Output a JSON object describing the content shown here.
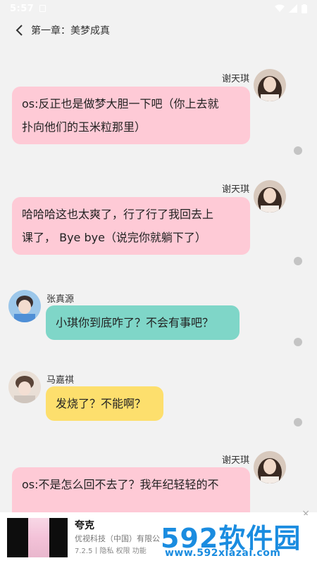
{
  "status_bar": {
    "time": "5:57"
  },
  "header": {
    "title": "第一章：美梦成真"
  },
  "messages": [
    {
      "speaker": "谢天琪",
      "side": "right",
      "color": "pink",
      "text_lines": [
        "os:反正也是做梦大胆一下吧（你上去就",
        "扑向他们的玉米粒那里）"
      ]
    },
    {
      "speaker": "谢天琪",
      "side": "right",
      "color": "pink",
      "text_lines": [
        "哈哈哈这也太爽了，行了行了我回去上",
        "课了， Bye bye（说完你就躺下了）"
      ]
    },
    {
      "speaker": "张真源",
      "side": "left",
      "color": "teal",
      "text_lines": [
        "小琪你到底咋了？不会有事吧？"
      ]
    },
    {
      "speaker": "马嘉祺",
      "side": "left",
      "color": "yellow",
      "text_lines": [
        "发烧了？不能啊？"
      ]
    },
    {
      "speaker": "谢天琪",
      "side": "right",
      "color": "pink",
      "text_lines": [
        "os:不是怎么回不去了？我年纪轻轻的不"
      ]
    }
  ],
  "ad": {
    "app_name": "夸克",
    "company": "优视科技（中国）有限公司",
    "meta": "7.2.5丨隐私 权限 功能",
    "close": "×"
  },
  "watermark": {
    "logo_num": "592",
    "logo_cn": "软件园",
    "url": "www.592xiazai.com"
  },
  "colors": {
    "pink": "#fecad6",
    "teal": "#7fd6c8",
    "yellow": "#fddf6d",
    "background": "#f2f2f2"
  }
}
